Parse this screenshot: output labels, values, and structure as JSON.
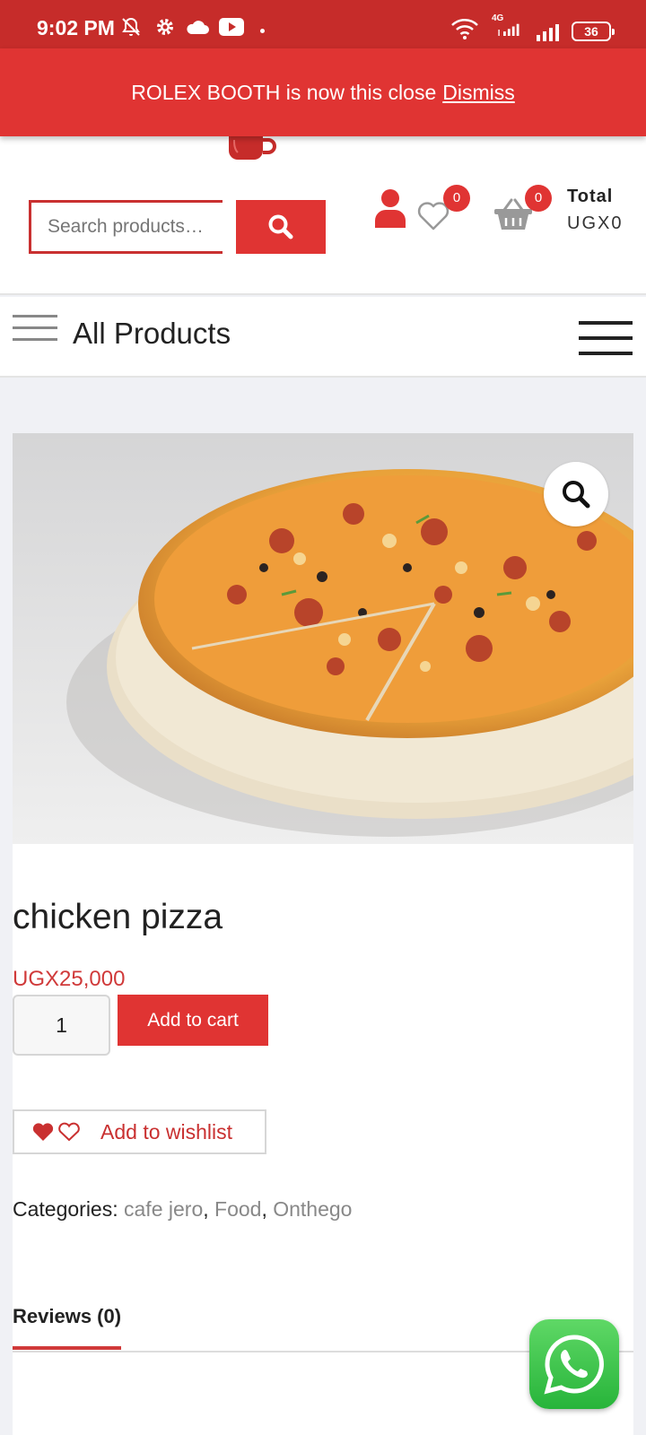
{
  "status_bar": {
    "time": "9:02 PM",
    "network_label": "4G",
    "battery": "36",
    "icons": [
      "mute-icon",
      "settings-icon",
      "cloud-icon",
      "youtube-icon",
      "wifi-icon",
      "signal-icon",
      "battery-icon"
    ]
  },
  "notice": {
    "text": "ROLEX BOOTH is now this close",
    "dismiss_label": "Dismiss"
  },
  "header": {
    "search_placeholder": "Search products…",
    "wishlist_count": "0",
    "cart_count": "0",
    "total_label": "Total",
    "total_value": "UGX0"
  },
  "nav": {
    "title": "All Products"
  },
  "product": {
    "title": "chicken pizza",
    "price": "UGX25,000",
    "quantity": "1",
    "add_to_cart_label": "Add to cart",
    "wishlist_label": "Add to wishlist",
    "categories_label": "Categories:",
    "categories": [
      "cafe jero",
      "Food",
      "Onthego"
    ],
    "image_alt": "pizza"
  },
  "tabs": {
    "reviews_label": "Reviews (0)"
  },
  "colors": {
    "accent": "#e03433",
    "status_bar": "#c62c2a",
    "price": "#d03a3a"
  }
}
